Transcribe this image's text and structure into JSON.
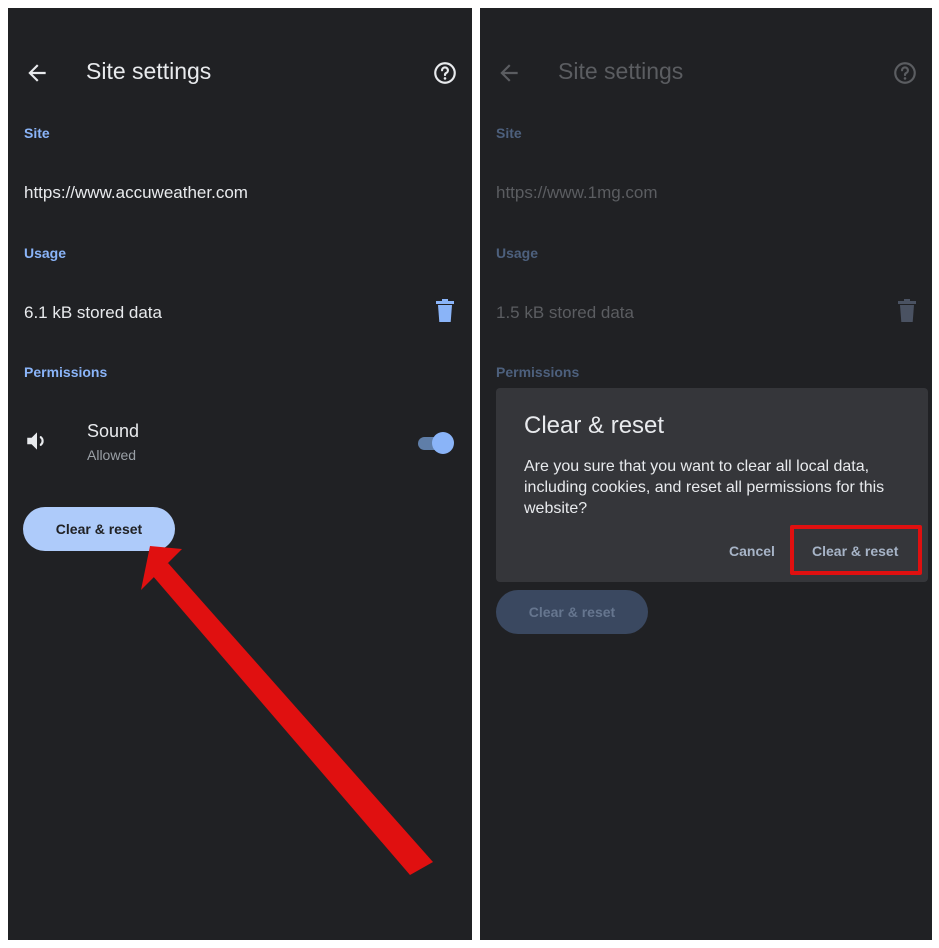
{
  "left": {
    "header": {
      "title": "Site settings"
    },
    "site": {
      "label": "Site",
      "url": "https://www.accuweather.com"
    },
    "usage": {
      "label": "Usage",
      "stored": "6.1 kB stored data"
    },
    "permissions": {
      "label": "Permissions",
      "sound": {
        "title": "Sound",
        "status": "Allowed",
        "enabled": true
      }
    },
    "clear_button": "Clear & reset"
  },
  "right": {
    "header": {
      "title": "Site settings"
    },
    "site": {
      "label": "Site",
      "url": "https://www.1mg.com"
    },
    "usage": {
      "label": "Usage",
      "stored": "1.5 kB stored data"
    },
    "permissions": {
      "label": "Permissions"
    },
    "clear_button": "Clear & reset",
    "dialog": {
      "title": "Clear & reset",
      "message": "Are you sure that you want to clear all local data, including cookies, and reset all permissions for this website?",
      "cancel": "Cancel",
      "confirm": "Clear & reset"
    }
  },
  "colors": {
    "background": "#202124",
    "accent": "#8ab4f8",
    "button": "#aecbfa",
    "highlight": "#e01010"
  },
  "icons": [
    "back-arrow-icon",
    "help-circle-icon",
    "trash-icon",
    "speaker-icon"
  ]
}
